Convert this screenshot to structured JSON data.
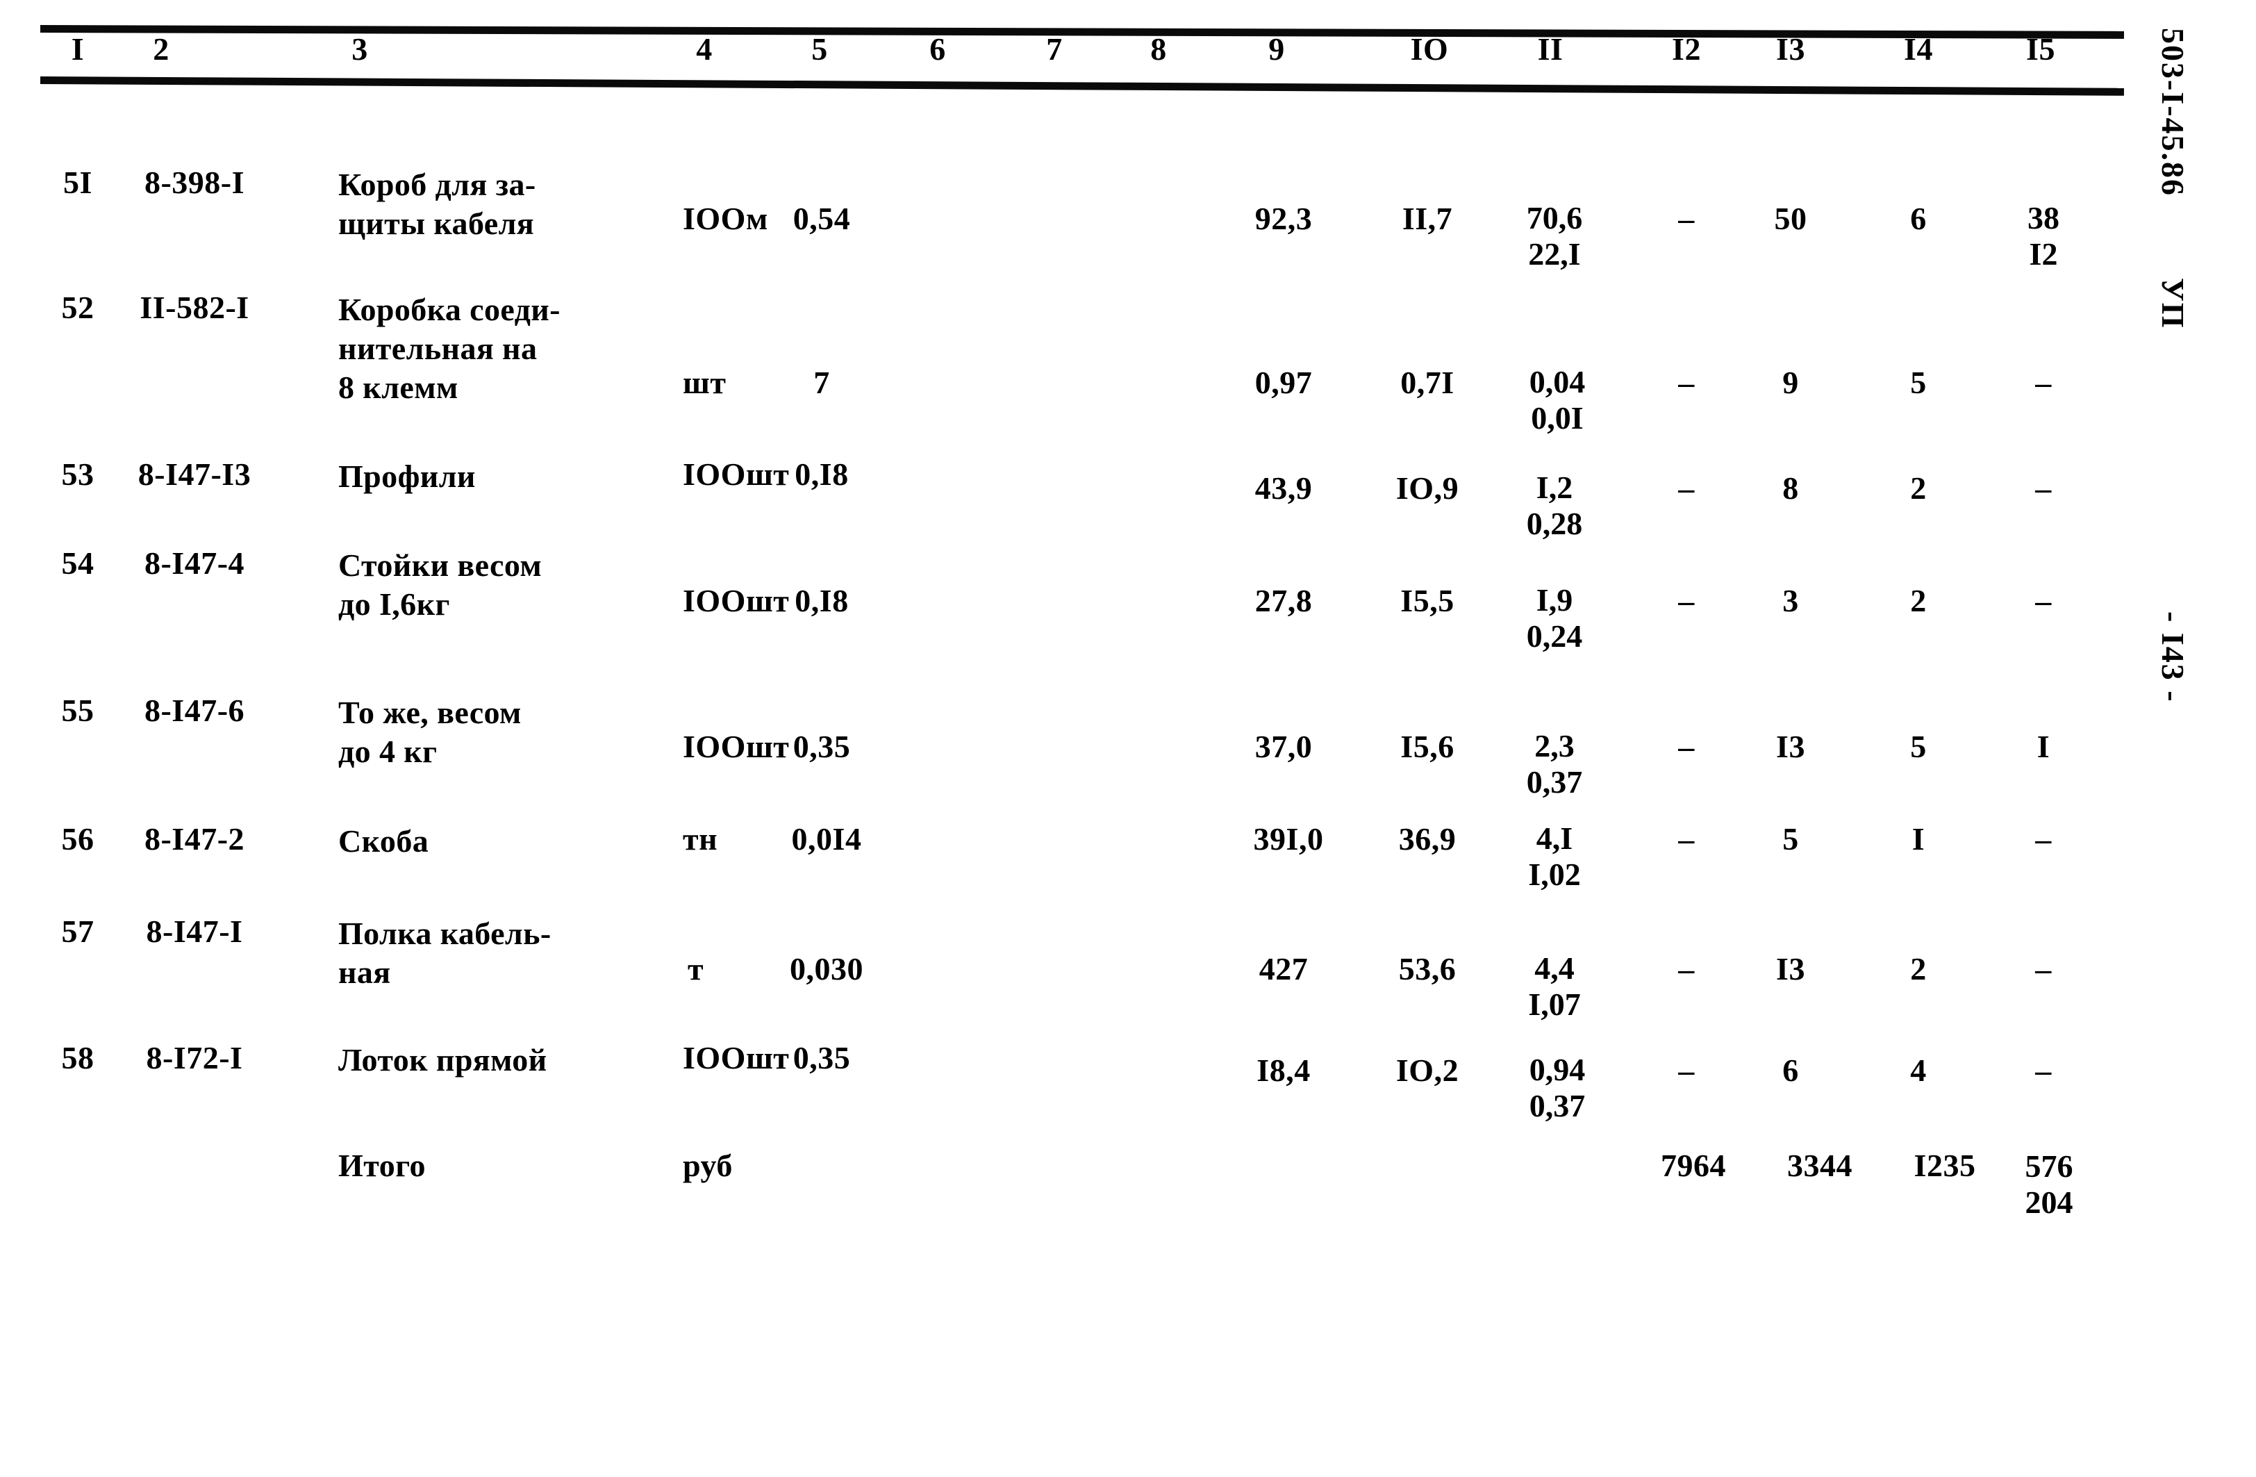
{
  "document": {
    "margin_code": "503-I-45.86",
    "margin_section": "УП",
    "page_marker": "- I43 -"
  },
  "table": {
    "column_headers": [
      "I",
      "2",
      "3",
      "4",
      "5",
      "6",
      "7",
      "8",
      "9",
      "IO",
      "II",
      "I2",
      "I3",
      "I4",
      "I5"
    ],
    "rows": [
      {
        "c1": "5I",
        "c2": "8-398-I",
        "c3": "Короб для за-\nщиты кабеля",
        "c4": "IOOм",
        "c5": "0,54",
        "c6": "",
        "c7": "",
        "c8": "",
        "c9": "92,3",
        "c10": "II,7",
        "c11": "70,6\n22,I",
        "c12": "–",
        "c13": "50",
        "c14": "6",
        "c15": "38\nI2"
      },
      {
        "c1": "52",
        "c2": "II-582-I",
        "c3": "Коробка соеди-\nнительная на\n8 клемм",
        "c4": "шт",
        "c5": "7",
        "c6": "",
        "c7": "",
        "c8": "",
        "c9": "0,97",
        "c10": "0,7I",
        "c11": "0,04\n0,0I",
        "c12": "–",
        "c13": "9",
        "c14": "5",
        "c15": "–"
      },
      {
        "c1": "53",
        "c2": "8-I47-I3",
        "c3": "Профили",
        "c4": "IOOшт",
        "c5": "0,I8",
        "c6": "",
        "c7": "",
        "c8": "",
        "c9": "43,9",
        "c10": "IO,9",
        "c11": "I,2\n0,28",
        "c12": "–",
        "c13": "8",
        "c14": "2",
        "c15": "–"
      },
      {
        "c1": "54",
        "c2": "8-I47-4",
        "c3": "Стойки весом\nдо I,6кг",
        "c4": "IOOшт",
        "c5": "0,I8",
        "c6": "",
        "c7": "",
        "c8": "",
        "c9": "27,8",
        "c10": "I5,5",
        "c11": "I,9\n0,24",
        "c12": "–",
        "c13": "3",
        "c14": "2",
        "c15": "–"
      },
      {
        "c1": "55",
        "c2": "8-I47-6",
        "c3": "То же, весом\nдо 4 кг",
        "c4": "IOOшт",
        "c5": "0,35",
        "c6": "",
        "c7": "",
        "c8": "",
        "c9": "37,0",
        "c10": "I5,6",
        "c11": "2,3\n0,37",
        "c12": "–",
        "c13": "I3",
        "c14": "5",
        "c15": "I"
      },
      {
        "c1": "56",
        "c2": "8-I47-2",
        "c3": "Скоба",
        "c4": "тн",
        "c5": "0,0I4",
        "c6": "",
        "c7": "",
        "c8": "",
        "c9": "39I,0",
        "c10": "36,9",
        "c11": "4,I\nI,02",
        "c12": "–",
        "c13": "5",
        "c14": "I",
        "c15": "–"
      },
      {
        "c1": "57",
        "c2": "8-I47-I",
        "c3": "Полка кабель-\nная",
        "c4": "т",
        "c5": "0,030",
        "c6": "",
        "c7": "",
        "c8": "",
        "c9": "427",
        "c10": "53,6",
        "c11": "4,4\nI,07",
        "c12": "–",
        "c13": "I3",
        "c14": "2",
        "c15": "–"
      },
      {
        "c1": "58",
        "c2": "8-I72-I",
        "c3": "Лоток прямой",
        "c4": "IOOшт",
        "c5": "0,35",
        "c6": "",
        "c7": "",
        "c8": "",
        "c9": "I8,4",
        "c10": "IO,2",
        "c11": "0,94\n0,37",
        "c12": "–",
        "c13": "6",
        "c14": "4",
        "c15": "–"
      }
    ],
    "total_row": {
      "label": "Итого",
      "unit": "руб",
      "c12": "7964",
      "c13": "3344",
      "c14": "I235",
      "c15": "576\n204"
    }
  }
}
